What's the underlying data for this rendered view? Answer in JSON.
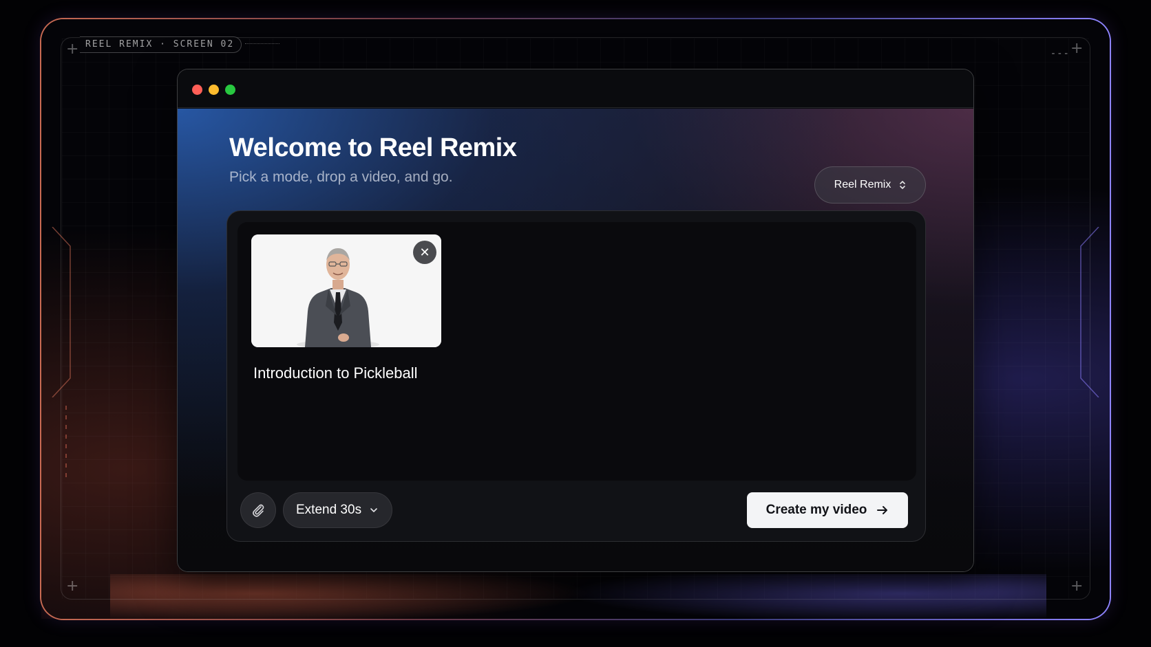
{
  "frame": {
    "label": "REEL REMIX · SCREEN 02",
    "corner_mark": "---"
  },
  "header": {
    "title": "Welcome to Reel Remix",
    "subtitle": "Pick a mode, drop a video, and go."
  },
  "app_selector": {
    "value": "Reel Remix",
    "icon": "updown-chevron-icon"
  },
  "upload": {
    "video_title": "Introduction to Pickleball",
    "thumbnail": "presenter-in-suit-thumbnail",
    "remove_icon": "close-icon",
    "remove_glyph": "✕"
  },
  "toolbar": {
    "attach_icon": "paperclip-icon",
    "mode_label": "Extend 30s",
    "mode_icon": "chevron-down-icon",
    "create_label": "Create my video",
    "create_icon": "arrow-right-icon"
  },
  "colors": {
    "accent_warm": "#c86a52",
    "accent_cool": "#8e84ff",
    "traffic_red": "#ff5f57",
    "traffic_yellow": "#febc2e",
    "traffic_green": "#28c840",
    "button_bg": "#f3f4f6"
  }
}
